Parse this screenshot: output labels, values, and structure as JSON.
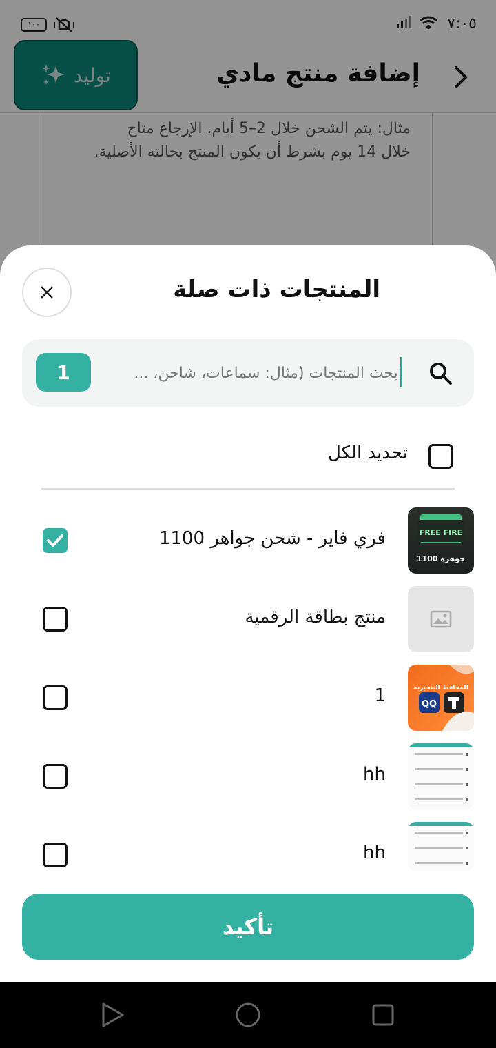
{
  "status_bar": {
    "time": "٧:٠٥",
    "battery": "١٠٠"
  },
  "header": {
    "title": "إضافة منتج مادي",
    "generate_label": "توليد"
  },
  "background": {
    "text": "مثال: يتم الشحن خلال 2–5 أيام. الإرجاع متاح خلال 14 يوم بشرط أن يكون المنتج بحالته الأصلية."
  },
  "sheet": {
    "title": "المنتجات ذات صلة",
    "search": {
      "placeholder": "ابحث المنتجات (مثال: سماعات، شاحن، ...",
      "selected_count": "1"
    },
    "select_all_label": "تحديد الكل",
    "products": [
      {
        "name": "فري فاير - شحن جواهر 1100",
        "checked": true,
        "thumb": "freefire-thumbnail",
        "thumb_text": "1100 جوهرة",
        "thumb_logo": "FREE FIRE"
      },
      {
        "name": "منتج بطاقة الرقمية",
        "checked": false,
        "thumb": "image-placeholder-icon"
      },
      {
        "name": "1",
        "checked": false,
        "thumb": "orange-app-thumbnail",
        "thumb_text": "المحافظ البنجيريه"
      },
      {
        "name": "hh",
        "checked": false,
        "thumb": "list-screenshot-thumbnail"
      },
      {
        "name": "hh",
        "checked": false,
        "thumb": "list-screenshot-thumbnail"
      }
    ],
    "confirm_label": "تأكيد"
  },
  "colors": {
    "accent": "#35b1a4",
    "generate_bg": "#0e8b7b",
    "overlay": "rgba(0,0,0,0.42)"
  }
}
